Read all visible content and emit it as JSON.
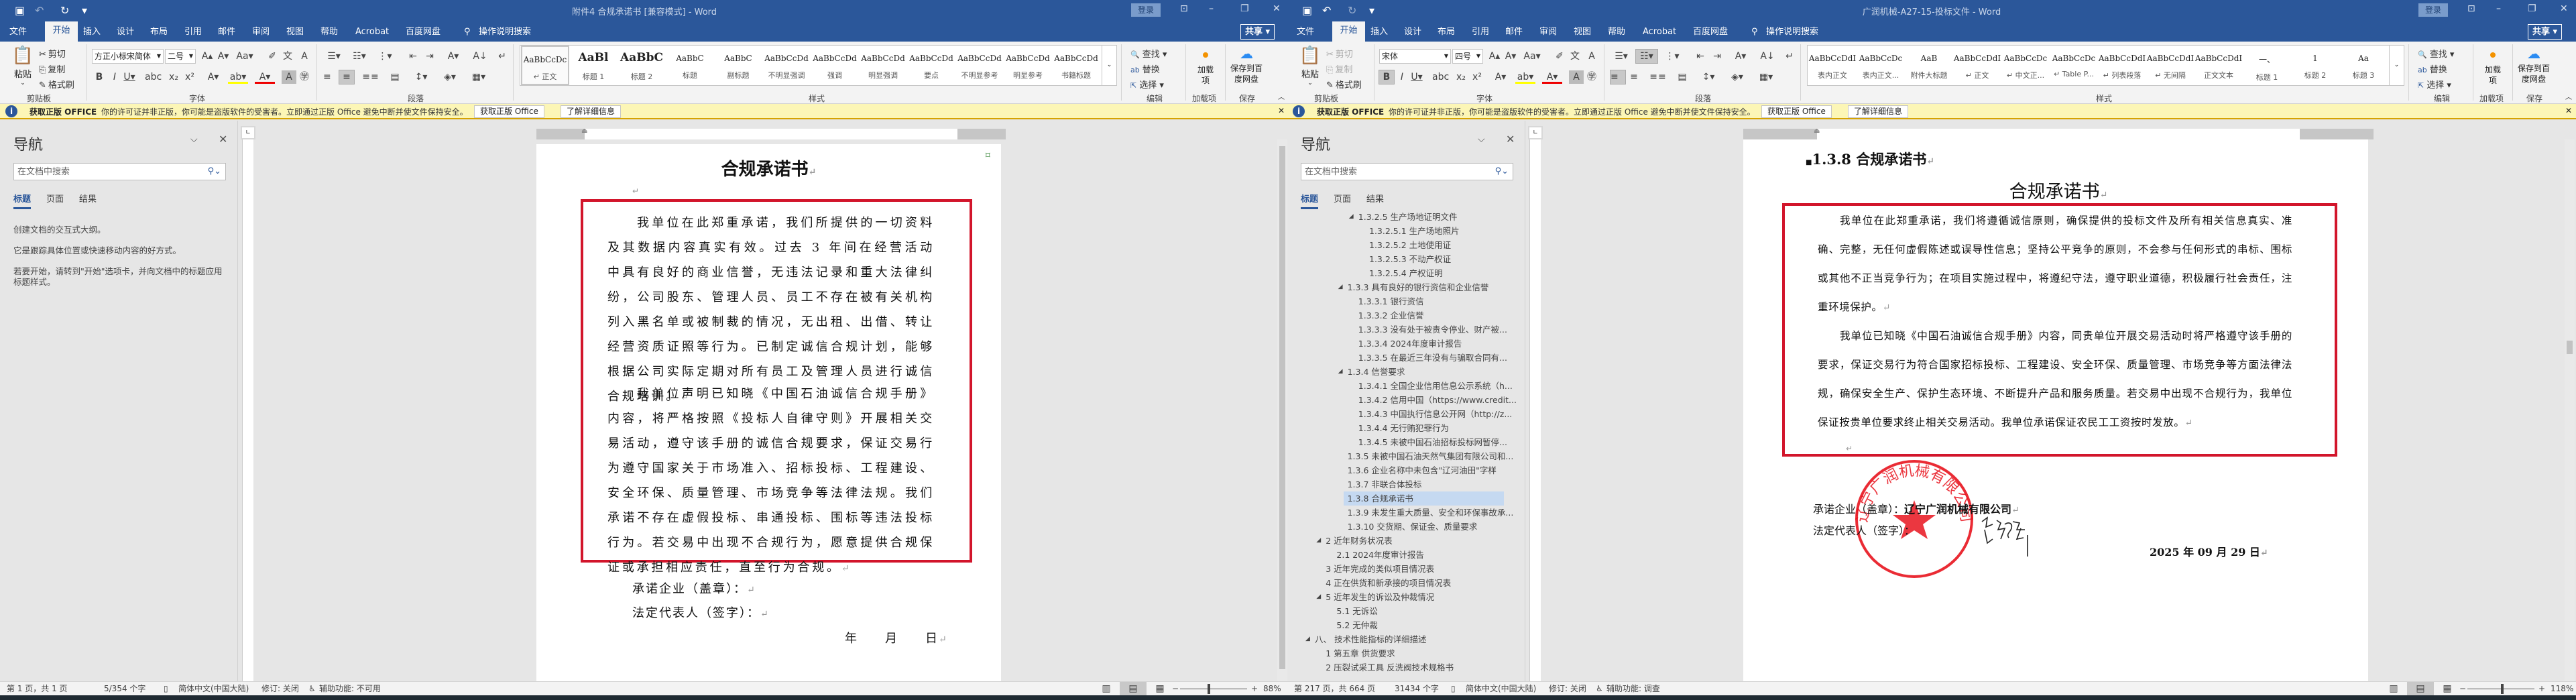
{
  "ribbon_icons": {
    "qat": [
      {
        "icon": "save-icon",
        "glyph": "▣"
      },
      {
        "icon": "undo-icon",
        "glyph": "↶"
      },
      {
        "icon": "redo-icon",
        "glyph": "↻"
      },
      {
        "icon": "customize-qat-icon",
        "glyph": "▾"
      }
    ],
    "window_controls": [
      {
        "icon": "ribbon-display-options-icon",
        "glyph": "⊡"
      },
      {
        "icon": "minimize-icon",
        "glyph": "–"
      },
      {
        "icon": "restore-icon",
        "glyph": "❐"
      },
      {
        "icon": "close-icon",
        "glyph": "✕"
      }
    ],
    "clipboard": [
      {
        "icon": "cut-icon",
        "glyph": "✂"
      },
      {
        "icon": "copy-icon",
        "glyph": "⎘"
      },
      {
        "icon": "format-painter-icon",
        "glyph": "✎"
      }
    ],
    "paste_glyph": "📋",
    "font_row1": [
      {
        "icon": "grow-font-icon",
        "glyph": "A▴"
      },
      {
        "icon": "shrink-font-icon",
        "glyph": "A▾"
      },
      {
        "icon": "change-case-icon",
        "glyph": "Aa▾"
      },
      {
        "icon": "clear-formatting-icon",
        "glyph": "✐"
      },
      {
        "icon": "phonetic-guide-icon",
        "glyph": "文"
      },
      {
        "icon": "character-border-icon",
        "glyph": "A"
      }
    ],
    "font_row2": [
      {
        "icon": "bold-icon",
        "glyph": "B"
      },
      {
        "icon": "italic-icon",
        "glyph": "I"
      },
      {
        "icon": "underline-icon",
        "glyph": "U▾"
      },
      {
        "icon": "strikethrough-icon",
        "glyph": "abc"
      },
      {
        "icon": "subscript-icon",
        "glyph": "x₂"
      },
      {
        "icon": "superscript-icon",
        "glyph": "x²"
      },
      {
        "icon": "text-effects-icon",
        "glyph": "A▾"
      },
      {
        "icon": "highlight-icon",
        "glyph": "ab▾"
      },
      {
        "icon": "font-color-icon",
        "glyph": "A▾"
      },
      {
        "icon": "character-shading-icon",
        "glyph": "A"
      },
      {
        "icon": "enclose-characters-icon",
        "glyph": "㊫"
      }
    ],
    "para_row1": [
      {
        "icon": "bullets-icon",
        "glyph": "☰▾"
      },
      {
        "icon": "numbering-icon",
        "glyph": "☷▾"
      },
      {
        "icon": "multilevel-list-icon",
        "glyph": "⋮▾"
      },
      {
        "icon": "decrease-indent-icon",
        "glyph": "⇤"
      },
      {
        "icon": "increase-indent-icon",
        "glyph": "⇥"
      },
      {
        "icon": "asian-layout-icon",
        "glyph": "A▾"
      },
      {
        "icon": "sort-icon",
        "glyph": "A↓"
      },
      {
        "icon": "show-marks-icon",
        "glyph": "↵"
      }
    ],
    "para_row2": [
      {
        "icon": "align-left-icon",
        "glyph": "≡"
      },
      {
        "icon": "align-center-icon",
        "glyph": "≡"
      },
      {
        "icon": "align-right-icon",
        "glyph": "≡"
      },
      {
        "icon": "justify-icon",
        "glyph": "≡"
      },
      {
        "icon": "distributed-icon",
        "glyph": "▤"
      },
      {
        "icon": "line-spacing-icon",
        "glyph": "↕▾"
      },
      {
        "icon": "shading-icon",
        "glyph": "◈▾"
      },
      {
        "icon": "borders-icon",
        "glyph": "▦▾"
      }
    ],
    "edit": [
      {
        "icon": "find-icon",
        "glyph": "🔍"
      },
      {
        "icon": "replace-icon",
        "glyph": "ab"
      },
      {
        "icon": "select-icon",
        "glyph": "⇱"
      }
    ],
    "status": [
      {
        "icon": "proofing-icon",
        "glyph": "▯"
      },
      {
        "icon": "accessibility-icon",
        "glyph": "♿"
      }
    ],
    "views": [
      {
        "icon": "read-mode-icon",
        "glyph": "▥"
      },
      {
        "icon": "print-layout-icon",
        "glyph": "▤"
      },
      {
        "icon": "web-layout-icon",
        "glyph": "▦"
      }
    ]
  },
  "colors": {
    "title_bar": "#2b579a",
    "info_bar": "#fcf6b6",
    "red_border": "#d2152b",
    "stamp": "#e8141e"
  },
  "windows": {
    "left": {
      "title": "附件4 合规承诺书 [兼容模式] - Word",
      "login": "登录",
      "share": "共享",
      "tabs": [
        "文件",
        "开始",
        "插入",
        "设计",
        "布局",
        "引用",
        "邮件",
        "审阅",
        "视图",
        "帮助",
        "Acrobat",
        "百度网盘"
      ],
      "active_tab": 1,
      "tell_me": "操作说明搜索",
      "active_tools": [
        "align-center-icon"
      ],
      "clipboard": {
        "paste": "粘贴",
        "cut": "剪切",
        "copy": "复制",
        "format_painter": "格式刷",
        "group": "剪贴板",
        "disabled": false
      },
      "font": {
        "name": "方正小标宋简体",
        "size": "二号",
        "group": "字体"
      },
      "paragraph_group": "段落",
      "styles_group": "样式",
      "styles": [
        {
          "preview": "AaBbCcDc",
          "label": "↵ 正文",
          "selected": true
        },
        {
          "preview": "AaBl",
          "label": "标题 1"
        },
        {
          "preview": "AaBbC",
          "label": "标题 2"
        },
        {
          "preview": "AaBbC",
          "label": "标题"
        },
        {
          "preview": "AaBbC",
          "label": "副标题"
        },
        {
          "preview": "AaBbCcDd",
          "label": "不明显强调"
        },
        {
          "preview": "AaBbCcDd",
          "label": "强调"
        },
        {
          "preview": "AaBbCcDd",
          "label": "明显强调"
        },
        {
          "preview": "AaBbCcDd",
          "label": "要点"
        },
        {
          "preview": "AaBbCcDd",
          "label": "不明显参考"
        },
        {
          "preview": "AaBbCcDd",
          "label": "明显参考"
        },
        {
          "preview": "AaBbCcDd",
          "label": "书籍标题"
        }
      ],
      "editing": {
        "find": "查找",
        "replace": "替换",
        "select": "选择",
        "group": "编辑"
      },
      "addins": {
        "label": "加载项",
        "group": "加载项"
      },
      "save": {
        "label": "保存到百度网盘",
        "group": "保存"
      },
      "infobar": {
        "title": "获取正版 OFFICE",
        "message": "你的许可证并非正版，你可能是盗版软件的受害者。立即通过正版 Office 避免中断并使文件保持安全。",
        "button1": "获取正版 Office",
        "button2": "了解详细信息"
      },
      "nav": {
        "title": "导航",
        "search_placeholder": "在文档中搜索",
        "tabs": [
          "标题",
          "页面",
          "结果"
        ],
        "messages": [
          "创建文档的交互式大纲。",
          "它是跟踪具体位置或快速移动内容的好方式。",
          "若要开始，请转到\"开始\"选项卡，并向文档中的标题应用标题样式。"
        ]
      },
      "doc": {
        "title": "合规承诺书",
        "para1": "我单位在此郑重承诺，我们所提供的一切资料及其数据内容真实有效。过去 3 年间在经营活动中具有良好的商业信誉，无违法记录和重大法律纠纷，公司股东、管理人员、员工不存在被有关机构列入黑名单或被制裁的情况，无出租、出借、转让经营资质证照等行为。已制定诚信合规计划，能够根据公司实际定期对所有员工及管理人员进行诚信合规培训。",
        "para2": "我单位声明已知晓《中国石油诚信合规手册》内容，将严格按照《投标人自律守则》开展相关交易活动，遵守该手册的诚信合规要求，保证交易行为遵守国家关于市场准入、招标投标、工程建设、安全环保、质量管理、市场竞争等法律法规。我们承诺不存在虚假投标、串通投标、围标等违法投标行为。若交易中出现不合规行为，愿意提供合规保证或承担相应责任，直至行为合规。",
        "company_label": "承诺企业（盖章）：",
        "rep_label": "法定代表人（签字）：",
        "date": "年　　月　　日"
      },
      "status": {
        "page": "第 1 页，共 1 页",
        "words": "5/354 个字",
        "language": "简体中文(中国大陆)",
        "track": "修订: 关闭",
        "accessibility": "辅助功能: 不可用",
        "zoom_label": "88%",
        "zoom": 88
      }
    },
    "right": {
      "title": "广润机械-A27-15-投标文件 - Word",
      "login": "登录",
      "share": "共享",
      "tabs": [
        "文件",
        "开始",
        "插入",
        "设计",
        "布局",
        "引用",
        "邮件",
        "审阅",
        "视图",
        "帮助",
        "Acrobat",
        "百度网盘"
      ],
      "active_tab": 1,
      "tell_me": "操作说明搜索",
      "active_tools": [
        "bold-icon",
        "numbering-icon",
        "align-left-icon"
      ],
      "clipboard": {
        "paste": "粘贴",
        "cut": "剪切",
        "copy": "复制",
        "format_painter": "格式刷",
        "group": "剪贴板",
        "disabled": true
      },
      "font": {
        "name": "宋体",
        "size": "四号",
        "group": "字体"
      },
      "paragraph_group": "段落",
      "styles_group": "样式",
      "styles": [
        {
          "preview": "AaBbCcDdI",
          "label": "表内正文"
        },
        {
          "preview": "AaBbCcDc",
          "label": "表内正文..."
        },
        {
          "preview": "AaB",
          "label": "附件大标题"
        },
        {
          "preview": "AaBbCcDdI",
          "label": "↵ 正文"
        },
        {
          "preview": "AaBbCcDc",
          "label": "↵ 中文正..."
        },
        {
          "preview": "AaBbCcDc",
          "label": "↵ Table P..."
        },
        {
          "preview": "AaBbCcDdI",
          "label": "↵ 列表段落"
        },
        {
          "preview": "AaBbCcDdI",
          "label": "↵ 无间隔"
        },
        {
          "preview": "AaBbCcDdI",
          "label": "正文文本"
        },
        {
          "preview": "一、",
          "label": "标题 1"
        },
        {
          "preview": "1",
          "label": "标题 2"
        },
        {
          "preview": "Aa",
          "label": "标题 3"
        }
      ],
      "editing": {
        "find": "查找",
        "replace": "替换",
        "select": "选择",
        "group": "编辑"
      },
      "addins": {
        "label": "加载项",
        "group": "加载项"
      },
      "save": {
        "label": "保存到百度网盘",
        "group": "保存"
      },
      "infobar": {
        "title": "获取正版 OFFICE",
        "message": "你的许可证并非正版，你可能是盗版软件的受害者。立即通过正版 Office 避免中断并使文件保持安全。",
        "button1": "获取正版 Office",
        "button2": "了解详细信息"
      },
      "nav": {
        "title": "导航",
        "search_placeholder": "在文档中搜索",
        "tabs": [
          "标题",
          "页面",
          "结果"
        ],
        "items": [
          {
            "text": "1.3.2.5 生产场地证明文件",
            "level": 5,
            "expanded": true
          },
          {
            "text": "1.3.2.5.1 生产场地照片",
            "level": 6
          },
          {
            "text": "1.3.2.5.2 土地使用证",
            "level": 6
          },
          {
            "text": "1.3.2.5.3 不动产权证",
            "level": 6
          },
          {
            "text": "1.3.2.5.4 产权证明",
            "level": 6
          },
          {
            "text": "1.3.3 具有良好的银行资信和企业信誉",
            "level": 4,
            "expanded": true
          },
          {
            "text": "1.3.3.1 银行资信",
            "level": 5
          },
          {
            "text": "1.3.3.2 企业信誉",
            "level": 5
          },
          {
            "text": "1.3.3.3 没有处于被责令停业、财产被...",
            "level": 5
          },
          {
            "text": "1.3.3.4 2024年度审计报告",
            "level": 5
          },
          {
            "text": "1.3.3.5 在最近三年没有与骗取合同有...",
            "level": 5
          },
          {
            "text": "1.3.4 信誉要求",
            "level": 4,
            "expanded": true
          },
          {
            "text": "1.3.4.1 全国企业信用信息公示系统（h...",
            "level": 5
          },
          {
            "text": "1.3.4.2 信用中国（https://www.credit...",
            "level": 5
          },
          {
            "text": "1.3.4.3 中国执行信息公开网（http://z...",
            "level": 5
          },
          {
            "text": "1.3.4.4 无行贿犯罪行为",
            "level": 5
          },
          {
            "text": "1.3.4.5 未被中国石油招标投标网暂停...",
            "level": 5
          },
          {
            "text": "1.3.5 未被中国石油天然气集团有限公司和...",
            "level": 4
          },
          {
            "text": "1.3.6 企业名称中未包含\"辽河油田\"字样",
            "level": 4
          },
          {
            "text": "1.3.7 非联合体投标",
            "level": 4
          },
          {
            "text": "1.3.8 合规承诺书",
            "level": 4,
            "selected": true
          },
          {
            "text": "1.3.9 未发生重大质量、安全和环保事故承...",
            "level": 4
          },
          {
            "text": "1.3.10 交货期、保证金、质量要求",
            "level": 4
          },
          {
            "text": "2 近年财务状况表",
            "level": 2,
            "expanded": true
          },
          {
            "text": "2.1 2024年度审计报告",
            "level": 3
          },
          {
            "text": "3 近年完成的类似项目情况表",
            "level": 2
          },
          {
            "text": "4 正在供货和新承接的项目情况表",
            "level": 2
          },
          {
            "text": "5 近年发生的诉讼及仲裁情况",
            "level": 2,
            "expanded": true
          },
          {
            "text": "5.1 无诉讼",
            "level": 3
          },
          {
            "text": "5.2 无仲裁",
            "level": 3
          },
          {
            "text": "八、 技术性能指标的详细描述",
            "level": 1,
            "expanded": true
          },
          {
            "text": "1 第五章 供货要求",
            "level": 2
          },
          {
            "text": "2 压裂试采工具 反洗阀技术规格书",
            "level": 2
          }
        ]
      },
      "doc": {
        "heading": "1.3.8 合规承诺书",
        "title": "合规承诺书",
        "para1": "我单位在此郑重承诺，我们将遵循诚信原则，确保提供的投标文件及所有相关信息真实、准确、完整，无任何虚假陈述或误导性信息；坚持公平竞争的原则，不会参与任何形式的串标、围标或其他不正当竞争行为；在项目实施过程中，将遵纪守法，遵守职业道德，积极履行社会责任，注重环境保护。",
        "para2": "我单位已知晓《中国石油诚信合规手册》内容，同贵单位开展交易活动时将严格遵守该手册的要求，保证交易行为符合国家招标投标、工程建设、安全环保、质量管理、市场竞争等方面法律法规，确保安全生产、保护生态环境、不断提升产品和服务质量。若交易中出现不合规行为，我单位保证按贵单位要求终止相关交易活动。我单位承诺保证农民工工资按时发放。",
        "company_label": "承诺企业（盖章）：",
        "company_name": "辽宁广润机械有限公司",
        "rep_label": "法定代表人（签字）：",
        "date": "2025 年 09 月 29 日",
        "stamp_text": "辽宁广润机械有限公司",
        "signature": "徐聊祥"
      },
      "status": {
        "page": "第 217 页，共 664 页",
        "words": "31434 个字",
        "language": "简体中文(中国大陆)",
        "track": "修订: 关闭",
        "accessibility": "辅助功能: 调查",
        "zoom_label": "118%",
        "zoom": 118
      }
    }
  }
}
